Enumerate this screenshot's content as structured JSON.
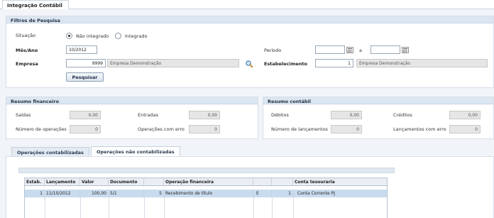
{
  "top_tab": "Integração Contábil",
  "filters": {
    "title": "Filtros de Pesquisa",
    "situacao_label": "Situação",
    "radio_nao": "Não integrado",
    "radio_int": "Integrado",
    "mesano_label": "Mês/Ano",
    "mesano_value": "10/2012",
    "empresa_label": "Empresa",
    "empresa_code": "9999",
    "empresa_name": "Empresa Demonstração",
    "periodo_label": "Período",
    "periodo_sep": "a",
    "estab_label": "Estabelecimento",
    "estab_code": "1",
    "estab_name": "Empresa Demonstração",
    "search_button": "Pesquisar"
  },
  "resumo_financeiro": {
    "title": "Resumo financeiro",
    "saidas_label": "Saídas",
    "saidas_value": "0,00",
    "entradas_label": "Entradas",
    "entradas_value": "0,00",
    "num_ops_label": "Número de operações",
    "num_ops_value": "0",
    "ops_erro_label": "Operações com erro",
    "ops_erro_value": "0"
  },
  "resumo_contabil": {
    "title": "Resumo contábil",
    "debitos_label": "Débitos",
    "debitos_value": "0,00",
    "creditos_label": "Créditos",
    "creditos_value": "0,00",
    "num_lanc_label": "Número de lançamentos",
    "num_lanc_value": "0",
    "lanc_erro_label": "Lançamentos com erro",
    "lanc_erro_value": "0"
  },
  "tabs": {
    "tab1": "Operações contabilizadas",
    "tab2": "Operações não contabilizadas"
  },
  "grid": {
    "headers": [
      "Estab.",
      "Lançamento",
      "Valor",
      "Documento",
      "",
      "Operação financeira",
      "",
      "",
      "Conta tesouraria"
    ],
    "row": [
      "1",
      "11/10/2012",
      "100,00",
      "5/1",
      "5",
      "Recebimento de título",
      "E",
      "1",
      "Conta Corrente PJ"
    ]
  },
  "colors": {
    "panel_header": "#dbe6f1",
    "selected_row": "#c9dbee",
    "background": "#f1f4f8"
  }
}
